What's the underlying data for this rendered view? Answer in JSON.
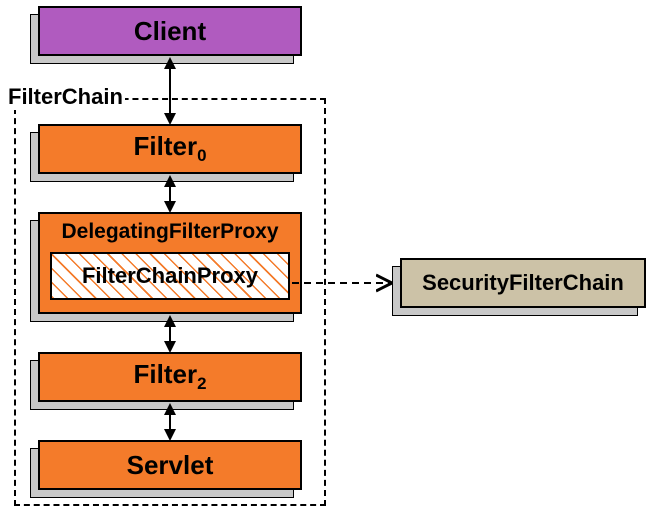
{
  "client": {
    "label": "Client"
  },
  "filterChain": {
    "label": "FilterChain"
  },
  "filter0": {
    "label": "Filter",
    "sub": "0"
  },
  "delegatingFilterProxy": {
    "label": "DelegatingFilterProxy"
  },
  "filterChainProxy": {
    "label": "FilterChainProxy"
  },
  "filter2": {
    "label": "Filter",
    "sub": "2"
  },
  "servlet": {
    "label": "Servlet"
  },
  "securityFilterChain": {
    "label": "SecurityFilterChain"
  },
  "colors": {
    "purple": "#b05bbf",
    "orange": "#f47b2a",
    "beige": "#ccc2a7",
    "shadow": "#c8c8c8"
  }
}
